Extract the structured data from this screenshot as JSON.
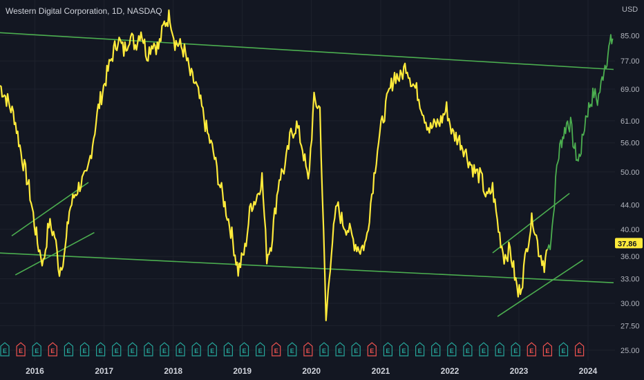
{
  "header": {
    "title": "Western Digital Corporation, 1D, NASDAQ",
    "currency": "USD"
  },
  "last_price_label": "37.86",
  "colors": {
    "background": "#131722",
    "price_line_main": "#ffeb3b",
    "price_line_recent": "#4caf50",
    "trendline": "#4caf50",
    "earnings_green": "#26a69a",
    "earnings_red": "#ef5350",
    "badge": "#ffeb3b"
  },
  "earnings_icon_letter": "E",
  "chart_data": {
    "type": "line",
    "title": "Western Digital Corporation, 1D, NASDAQ",
    "xlabel": "",
    "ylabel": "",
    "y_scale": "log",
    "ylim": [
      24,
      94
    ],
    "grid": true,
    "y_ticks": [
      "85.00",
      "77.00",
      "69.00",
      "61.00",
      "56.00",
      "50.00",
      "44.00",
      "40.00",
      "36.00",
      "33.00",
      "30.00",
      "27.50",
      "25.00"
    ],
    "x_ticks": [
      "2016",
      "2017",
      "2018",
      "2019",
      "2020",
      "2021",
      "2022",
      "2023",
      "2024"
    ],
    "xlim": [
      "2015-07-01",
      "2024-05-15"
    ],
    "series": [
      {
        "values_x": [
          "2015-07-01",
          "2015-08-10",
          "2015-09-15",
          "2015-10-20",
          "2015-12-01",
          "2016-01-15",
          "2016-02-15",
          "2016-03-15",
          "2016-04-15",
          "2016-05-10",
          "2016-06-10",
          "2016-07-01",
          "2016-08-01",
          "2016-09-01",
          "2016-10-01",
          "2016-11-01",
          "2016-12-01",
          "2017-01-10",
          "2017-02-15",
          "2017-03-15",
          "2017-04-15",
          "2017-05-15",
          "2017-06-15",
          "2017-07-15",
          "2017-08-15",
          "2017-09-15",
          "2017-10-15",
          "2017-11-15",
          "2017-12-15",
          "2018-01-10",
          "2018-02-01",
          "2018-03-01",
          "2018-04-01",
          "2018-05-01",
          "2018-06-01",
          "2018-07-01",
          "2018-08-01",
          "2018-09-01",
          "2018-10-01",
          "2018-11-01",
          "2018-12-10",
          "2019-01-15",
          "2019-02-15",
          "2019-03-15",
          "2019-04-15",
          "2019-05-10",
          "2019-06-03",
          "2019-07-15",
          "2019-08-15",
          "2019-09-15",
          "2019-10-15",
          "2019-11-15",
          "2019-12-15",
          "2020-01-15",
          "2020-02-15",
          "2020-03-18",
          "2020-04-15",
          "2020-05-15",
          "2020-06-15",
          "2020-07-15",
          "2020-08-15",
          "2020-09-15",
          "2020-10-15",
          "2020-11-15",
          "2020-12-15",
          "2021-01-15",
          "2021-02-15",
          "2021-03-15",
          "2021-04-15",
          "2021-05-15",
          "2021-06-15",
          "2021-07-15",
          "2021-08-15",
          "2021-09-15",
          "2021-10-15",
          "2021-11-15",
          "2021-12-15",
          "2022-01-15",
          "2022-02-15",
          "2022-03-15",
          "2022-04-15",
          "2022-05-15",
          "2022-06-15",
          "2022-07-15",
          "2022-08-15",
          "2022-09-15",
          "2022-10-15",
          "2022-11-15",
          "2022-12-28",
          "2023-01-20",
          "2023-02-15",
          "2023-03-15",
          "2023-04-15",
          "2023-05-15",
          "2023-06-01"
        ],
        "values": [
          70,
          66,
          62,
          54,
          47,
          38,
          35,
          41,
          39,
          34,
          37,
          43,
          46,
          48,
          49,
          56,
          64,
          72,
          79,
          84,
          80,
          85,
          82,
          87,
          79,
          83,
          81,
          89,
          92,
          83,
          82,
          80,
          73,
          70,
          64,
          58,
          54,
          48,
          44,
          40,
          34,
          37,
          44,
          45,
          49,
          36,
          38,
          49,
          51,
          58,
          60,
          55,
          48,
          66,
          64,
          28,
          37,
          44,
          41,
          40,
          38,
          37,
          38,
          46,
          55,
          62,
          68,
          73,
          72,
          76,
          71,
          68,
          63,
          59,
          60,
          61,
          64,
          58,
          57,
          55,
          52,
          50,
          49,
          45,
          47,
          40,
          36,
          37,
          31,
          33,
          38,
          42,
          37,
          35,
          37
        ],
        "name": ""
      },
      {
        "values_x": [
          "2023-06-01",
          "2023-06-15",
          "2023-07-01",
          "2023-07-20",
          "2023-08-10",
          "2023-08-25",
          "2023-09-15",
          "2023-10-01",
          "2023-10-20",
          "2023-11-10",
          "2023-12-01",
          "2023-12-20",
          "2024-01-10",
          "2024-02-01",
          "2024-02-20",
          "2024-03-10",
          "2024-03-25",
          "2024-04-10",
          "2024-04-25",
          "2024-05-10"
        ],
        "values": [
          37,
          38,
          42,
          51,
          56,
          58,
          61,
          60,
          55,
          52,
          56,
          62,
          65,
          68,
          66,
          70,
          75,
          78,
          82,
          84
        ],
        "name": ""
      }
    ],
    "trendlines": [
      {
        "from": [
          "2015-06-15",
          86.0
        ],
        "to": [
          "2024-05-15",
          74.5
        ]
      },
      {
        "from": [
          "2015-06-15",
          36.5
        ],
        "to": [
          "2024-05-15",
          32.5
        ]
      },
      {
        "from": [
          "2015-09-01",
          39.0
        ],
        "to": [
          "2016-10-10",
          48.0
        ]
      },
      {
        "from": [
          "2015-09-20",
          33.5
        ],
        "to": [
          "2016-11-10",
          39.5
        ]
      },
      {
        "from": [
          "2022-08-15",
          36.5
        ],
        "to": [
          "2023-09-25",
          46.0
        ]
      },
      {
        "from": [
          "2022-09-10",
          28.5
        ],
        "to": [
          "2023-12-05",
          35.5
        ]
      }
    ],
    "earnings": [
      "G",
      "R",
      "G",
      "R",
      "G",
      "G",
      "G",
      "G",
      "G",
      "G",
      "G",
      "G",
      "G",
      "G",
      "G",
      "G",
      "G",
      "R",
      "G",
      "R",
      "G",
      "G",
      "G",
      "R",
      "G",
      "G",
      "G",
      "G",
      "G",
      "G",
      "G",
      "G",
      "G",
      "R",
      "R",
      "G",
      "R"
    ]
  }
}
